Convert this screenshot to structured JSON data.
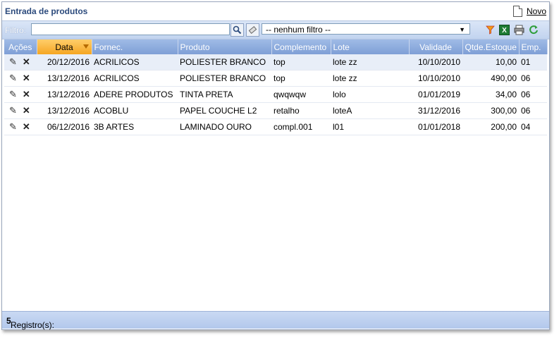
{
  "header": {
    "title": "Entrada de produtos",
    "new_label": "Novo"
  },
  "filter": {
    "label": "Filtro:",
    "value": "",
    "select_value": "-- nenhum filtro --"
  },
  "columns": [
    {
      "label": "Ações"
    },
    {
      "label": "Data"
    },
    {
      "label": "Fornec."
    },
    {
      "label": "Produto"
    },
    {
      "label": "Complemento"
    },
    {
      "label": "Lote"
    },
    {
      "label": "Validade"
    },
    {
      "label": "Qtde.Estoque"
    },
    {
      "label": "Emp."
    }
  ],
  "rows": [
    {
      "data": "20/12/2016",
      "fornec": "ACRILICOS",
      "produto": "POLIESTER BRANCO",
      "complemento": "top",
      "lote": "lote zz",
      "validade": "10/10/2010",
      "qtde": "10,00",
      "emp": "01"
    },
    {
      "data": "13/12/2016",
      "fornec": "ACRILICOS",
      "produto": "POLIESTER BRANCO",
      "complemento": "top",
      "lote": "lote zz",
      "validade": "10/10/2010",
      "qtde": "490,00",
      "emp": "06"
    },
    {
      "data": "13/12/2016",
      "fornec": "ADERE PRODUTOS",
      "produto": "TINTA PRETA",
      "complemento": "qwqwqw",
      "lote": "lolo",
      "validade": "01/01/2019",
      "qtde": "34,00",
      "emp": "06"
    },
    {
      "data": "13/12/2016",
      "fornec": "ACOBLU",
      "produto": "PAPEL COUCHE L2",
      "complemento": "retalho",
      "lote": "loteA",
      "validade": "31/12/2016",
      "qtde": "300,00",
      "emp": "06"
    },
    {
      "data": "06/12/2016",
      "fornec": "3B ARTES",
      "produto": "LAMINADO OURO",
      "complemento": "compl.001",
      "lote": "l01",
      "validade": "01/01/2018",
      "qtde": "200,00",
      "emp": "04"
    }
  ],
  "footer": {
    "label": "Registro(s):",
    "count": "5"
  },
  "colors": {
    "header_blue": "#7f9fd6",
    "sorted_orange": "#f5a623",
    "title_blue": "#2b4a7c"
  }
}
